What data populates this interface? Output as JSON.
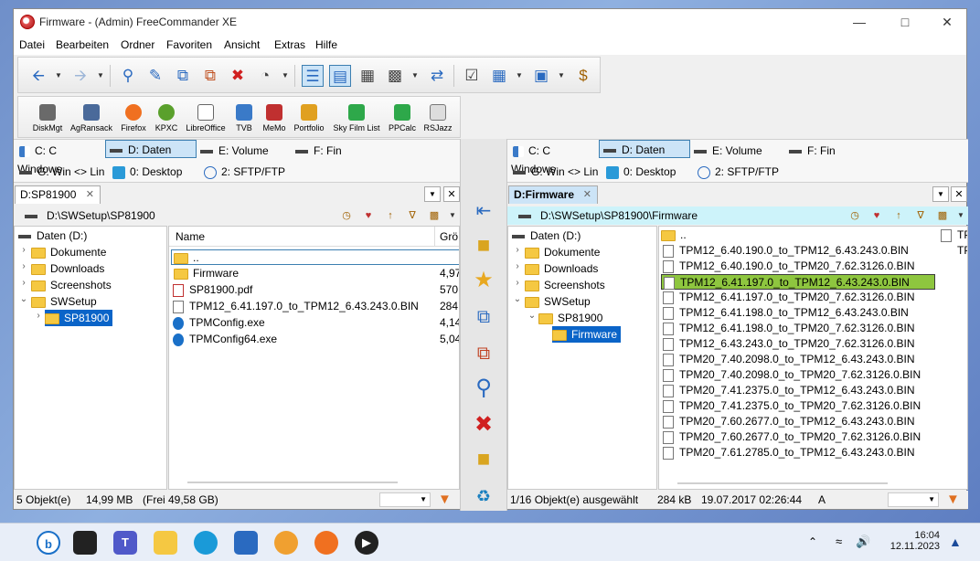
{
  "window": {
    "title": "Firmware - (Admin) FreeCommander XE"
  },
  "menu": [
    "Datei",
    "Bearbeiten",
    "Ordner",
    "Favoriten",
    "Ansicht",
    "Extras",
    "Hilfe"
  ],
  "programs": [
    "DiskMgt",
    "AgRansack",
    "Firefox",
    "KPXC",
    "LibreOffice",
    "TVB",
    "MeMo",
    "Portfolio",
    "Sky Film List",
    "PPCalc",
    "RSJazz"
  ],
  "drives": {
    "row1": [
      "C: C Windows",
      "D: Daten",
      "E: Volume",
      "F: Fin"
    ],
    "row2": [
      "G: Win <> Lin",
      "0: Desktop",
      "2: SFTP/FTP"
    ]
  },
  "left": {
    "tab": "D:SP81900",
    "path": "D:\\SWSetup\\SP81900",
    "tree": {
      "root": "Daten (D:)",
      "items": [
        "Dokumente",
        "Downloads",
        "Screenshots",
        "SWSetup"
      ],
      "sub": "SP81900"
    },
    "columns": {
      "name": "Name",
      "size": "Grö"
    },
    "files": [
      {
        "name": "..",
        "size": ""
      },
      {
        "name": "Firmware",
        "size": "4,97"
      },
      {
        "name": "SP81900.pdf",
        "size": "570"
      },
      {
        "name": "TPM12_6.41.197.0_to_TPM12_6.43.243.0.BIN",
        "size": "284"
      },
      {
        "name": "TPMConfig.exe",
        "size": "4,14"
      },
      {
        "name": "TPMConfig64.exe",
        "size": "5,04"
      }
    ],
    "status": {
      "count": "5 Objekt(e)",
      "size": "14,99 MB",
      "free": "(Frei 49,58 GB)"
    }
  },
  "right": {
    "tab": "D:Firmware",
    "path": "D:\\SWSetup\\SP81900\\Firmware",
    "tree": {
      "root": "Daten (D:)",
      "items": [
        "Dokumente",
        "Downloads",
        "Screenshots",
        "SWSetup"
      ],
      "sub": "SP81900",
      "sub2": "Firmware"
    },
    "files": [
      "..",
      "TPM12_6.40.190.0_to_TPM12_6.43.243.0.BIN",
      "TPM12_6.40.190.0_to_TPM20_7.62.3126.0.BIN",
      "TPM12_6.41.197.0_to_TPM12_6.43.243.0.BIN",
      "TPM12_6.41.197.0_to_TPM20_7.62.3126.0.BIN",
      "TPM12_6.41.198.0_to_TPM12_6.43.243.0.BIN",
      "TPM12_6.41.198.0_to_TPM20_7.62.3126.0.BIN",
      "TPM12_6.43.243.0_to_TPM20_7.62.3126.0.BIN",
      "TPM20_7.40.2098.0_to_TPM12_6.43.243.0.BIN",
      "TPM20_7.40.2098.0_to_TPM20_7.62.3126.0.BIN",
      "TPM20_7.41.2375.0_to_TPM12_6.43.243.0.BIN",
      "TPM20_7.41.2375.0_to_TPM20_7.62.3126.0.BIN",
      "TPM20_7.60.2677.0_to_TPM12_6.43.243.0.BIN",
      "TPM20_7.60.2677.0_to_TPM20_7.62.3126.0.BIN",
      "TPM20_7.61.2785.0_to_TPM12_6.43.243.0.BIN"
    ],
    "extra_col": [
      "TP",
      "TP"
    ],
    "status": {
      "selected": "1/16 Objekt(e) ausgewählt",
      "size": "284 kB",
      "date": "19.07.2017 02:26:44",
      "attr": "A"
    }
  },
  "clock": {
    "time": "16:04",
    "date": "12.11.2023"
  },
  "colors": {
    "accent": "#3c7fb1",
    "highlight": "#8ec63f",
    "selection": "#cce4f7"
  }
}
